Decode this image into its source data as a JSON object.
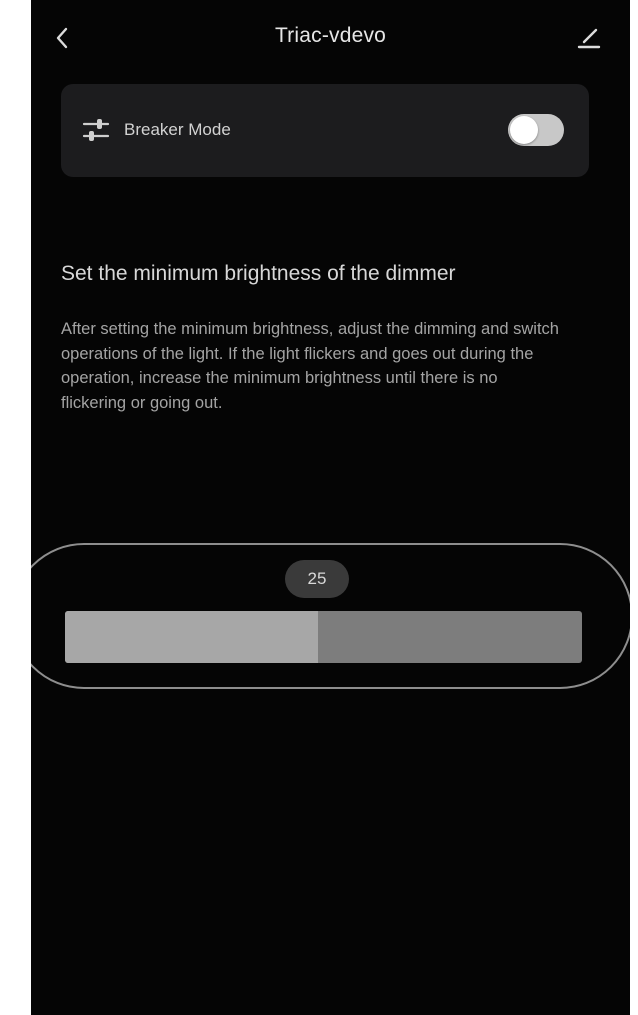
{
  "header": {
    "title": "Triac-vdevo",
    "back_icon": "chevron-left-icon",
    "edit_icon": "pencil-icon"
  },
  "breaker_mode": {
    "label": "Breaker Mode",
    "icon": "sliders-icon",
    "enabled": false
  },
  "brightness": {
    "heading": "Set the minimum brightness of the dimmer",
    "description": "After setting the minimum brightness, adjust the dimming and switch operations of the light. If the light flickers and goes out during the operation, increase the minimum brightness until there is no flickering or going out.",
    "value": "25",
    "fill_fraction": 0.49
  },
  "colors": {
    "background": "#050505",
    "card": "#1c1c1e",
    "track": "#7d7d7d",
    "fill": "#a7a7a7",
    "toggle_off": "#c8c8c8"
  }
}
